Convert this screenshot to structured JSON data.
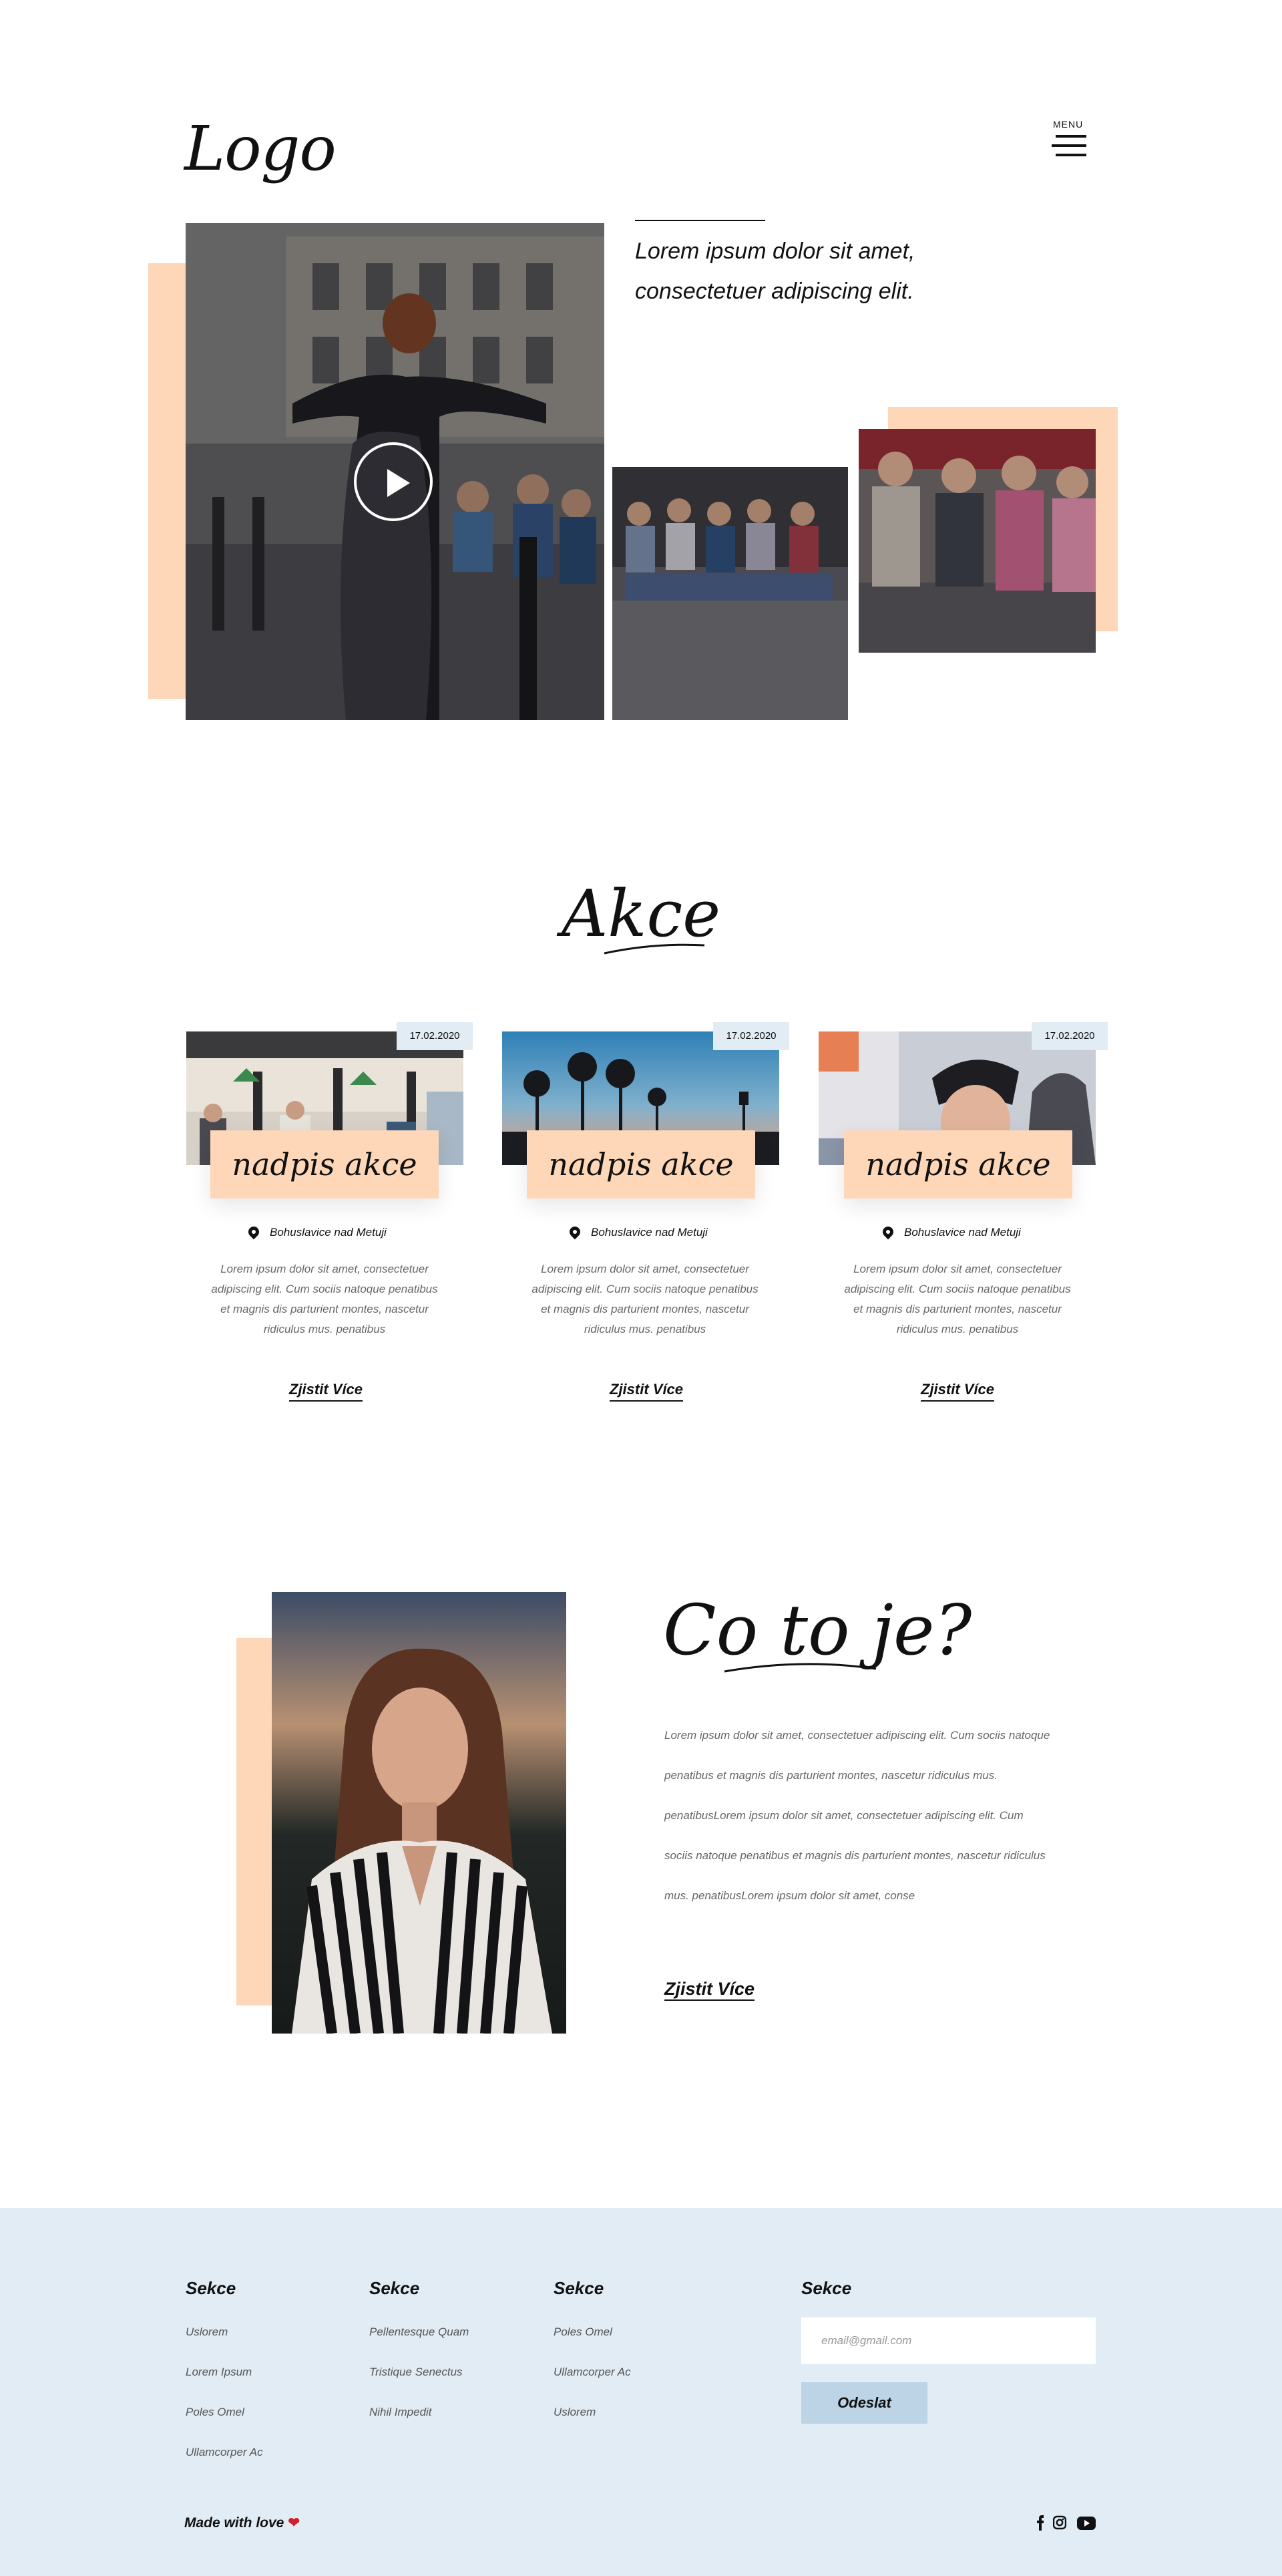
{
  "header": {
    "logo": "Logo",
    "menu_label": "MENU"
  },
  "hero": {
    "text": "Lorem ipsum dolor sit amet, consectetuer adipiscing elit."
  },
  "events": {
    "title": "Akce",
    "cards": [
      {
        "date": "17.02.2020",
        "title": "nadpis akce",
        "location": "Bohuslavice nad Metuji",
        "description": "Lorem ipsum dolor sit amet, consectetuer adipiscing elit. Cum sociis natoque penatibus et magnis dis parturient montes, nascetur ridiculus mus. penatibus",
        "link": "Zjistit Více"
      },
      {
        "date": "17.02.2020",
        "title": "nadpis akce",
        "location": "Bohuslavice nad Metuji",
        "description": "Lorem ipsum dolor sit amet, consectetuer adipiscing elit. Cum sociis natoque penatibus et magnis dis parturient montes, nascetur ridiculus mus. penatibus",
        "link": "Zjistit Více"
      },
      {
        "date": "17.02.2020",
        "title": "nadpis akce",
        "location": "Bohuslavice nad Metuji",
        "description": "Lorem ipsum dolor sit amet, consectetuer adipiscing elit. Cum sociis natoque penatibus et magnis dis parturient montes, nascetur ridiculus mus. penatibus",
        "link": "Zjistit Více"
      }
    ]
  },
  "about": {
    "title": "Co to je?",
    "text": "Lorem ipsum dolor sit amet, consectetuer adipiscing elit. Cum sociis natoque penatibus et magnis dis parturient montes, nascetur ridiculus mus. penatibusLorem ipsum dolor sit amet, consectetuer adipiscing elit. Cum sociis natoque penatibus et magnis dis parturient montes, nascetur ridiculus mus. penatibusLorem ipsum dolor sit amet, conse",
    "link": "Zjistit Více"
  },
  "footer": {
    "columns": [
      {
        "heading": "Sekce",
        "links": [
          "Uslorem",
          "Lorem Ipsum",
          "Poles Omel",
          "Ullamcorper Ac"
        ]
      },
      {
        "heading": "Sekce",
        "links": [
          "Pellentesque Quam",
          "Tristique Senectus",
          "Nihil Impedit"
        ]
      },
      {
        "heading": "Sekce",
        "links": [
          "Poles Omel",
          "Ullamcorper Ac",
          "Uslorem"
        ]
      }
    ],
    "newsletter": {
      "heading": "Sekce",
      "placeholder": "email@gmail.com",
      "button": "Odeslat"
    },
    "made_with": "Made with love",
    "social_icons": [
      "facebook-icon",
      "instagram-icon",
      "youtube-icon"
    ]
  },
  "colors": {
    "accent_peach": "#fdd7b8",
    "footer_bg": "#e1ecf5",
    "button_bg": "#bdd4e7",
    "heart": "#d21e2b"
  }
}
